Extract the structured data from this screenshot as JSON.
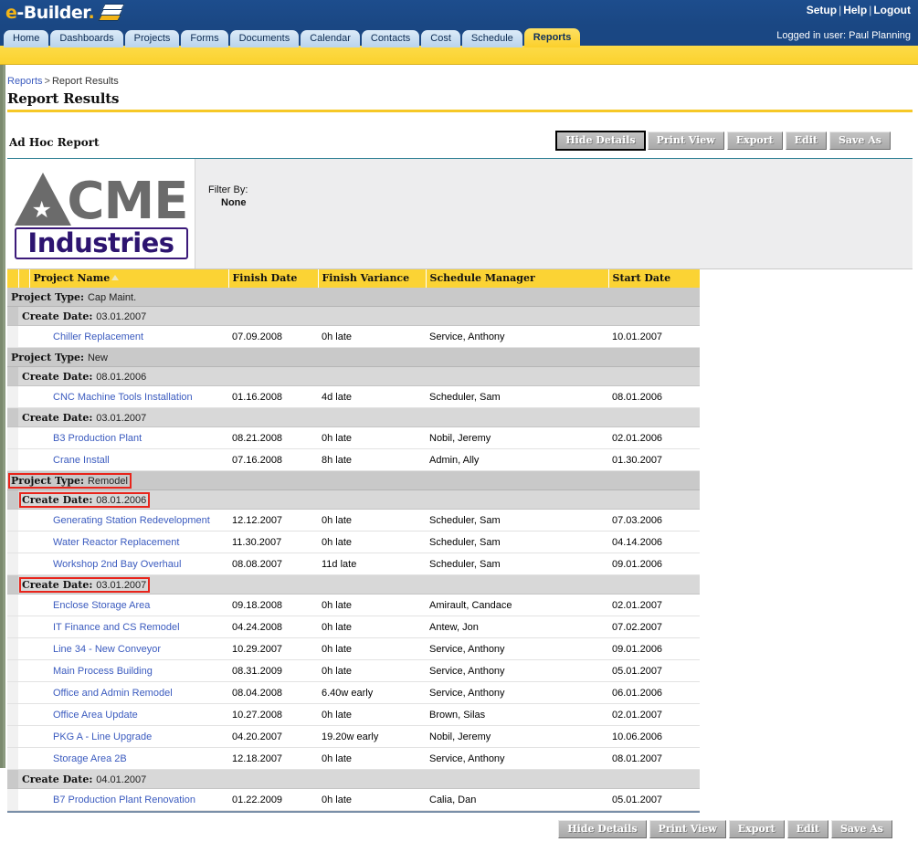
{
  "brand": {
    "name_prefix": "e",
    "name_main": "-Builder",
    "name_dot": "."
  },
  "topnav": {
    "setup": "Setup",
    "help": "Help",
    "logout": "Logout",
    "sep": "|"
  },
  "tabs": [
    {
      "label": "Home",
      "active": false
    },
    {
      "label": "Dashboards",
      "active": false
    },
    {
      "label": "Projects",
      "active": false
    },
    {
      "label": "Forms",
      "active": false
    },
    {
      "label": "Documents",
      "active": false
    },
    {
      "label": "Calendar",
      "active": false
    },
    {
      "label": "Contacts",
      "active": false
    },
    {
      "label": "Cost",
      "active": false
    },
    {
      "label": "Schedule",
      "active": false
    },
    {
      "label": "Reports",
      "active": true
    }
  ],
  "logged_in": "Logged in user: Paul Planning",
  "breadcrumb": {
    "parent": "Reports",
    "sep": ">",
    "current": "Report Results"
  },
  "page_title": "Report Results",
  "report": {
    "title": "Ad Hoc Report",
    "filter_label": "Filter By:",
    "filter_value": "None",
    "logo": {
      "star": "★",
      "word_top": "CME",
      "word_bottom": "Industries"
    }
  },
  "buttons": [
    {
      "label": "Hide Details",
      "focused": true
    },
    {
      "label": "Print View",
      "focused": false
    },
    {
      "label": "Export",
      "focused": false
    },
    {
      "label": "Edit",
      "focused": false
    },
    {
      "label": "Save As",
      "focused": false
    }
  ],
  "buttons_bottom": [
    {
      "label": "Hide Details",
      "focused": false
    },
    {
      "label": "Print View",
      "focused": false
    },
    {
      "label": "Export",
      "focused": false
    },
    {
      "label": "Edit",
      "focused": false
    },
    {
      "label": "Save As",
      "focused": false
    }
  ],
  "table": {
    "columns": [
      "Project Name",
      "Finish Date",
      "Finish Variance",
      "Schedule Manager",
      "Start Date"
    ],
    "sort_column": "Project Name",
    "sort_direction": "ascending",
    "group_label": "Project Type:",
    "subgroup_label": "Create Date:",
    "rows": [
      {
        "kind": "group",
        "value": "Cap Maint.",
        "highlight": false
      },
      {
        "kind": "subgroup",
        "value": "03.01.2007",
        "highlight": false
      },
      {
        "kind": "data",
        "name": "Chiller Replacement",
        "finish": "07.09.2008",
        "variance": "0h late",
        "manager": "Service, Anthony",
        "start": "10.01.2007"
      },
      {
        "kind": "group",
        "value": "New",
        "highlight": false
      },
      {
        "kind": "subgroup",
        "value": "08.01.2006",
        "highlight": false
      },
      {
        "kind": "data",
        "name": "CNC Machine Tools Installation",
        "finish": "01.16.2008",
        "variance": "4d late",
        "manager": "Scheduler, Sam",
        "start": "08.01.2006"
      },
      {
        "kind": "subgroup",
        "value": "03.01.2007",
        "highlight": false
      },
      {
        "kind": "data",
        "name": "B3 Production Plant",
        "finish": "08.21.2008",
        "variance": "0h late",
        "manager": "Nobil, Jeremy",
        "start": "02.01.2006"
      },
      {
        "kind": "data",
        "name": "Crane Install",
        "finish": "07.16.2008",
        "variance": "8h late",
        "manager": "Admin, Ally",
        "start": "01.30.2007"
      },
      {
        "kind": "group",
        "value": "Remodel",
        "highlight": true
      },
      {
        "kind": "subgroup",
        "value": "08.01.2006",
        "highlight": true
      },
      {
        "kind": "data",
        "name": "Generating Station Redevelopment",
        "finish": "12.12.2007",
        "variance": "0h late",
        "manager": "Scheduler, Sam",
        "start": "07.03.2006"
      },
      {
        "kind": "data",
        "name": "Water Reactor Replacement",
        "finish": "11.30.2007",
        "variance": "0h late",
        "manager": "Scheduler, Sam",
        "start": "04.14.2006"
      },
      {
        "kind": "data",
        "name": "Workshop 2nd Bay Overhaul",
        "finish": "08.08.2007",
        "variance": "11d late",
        "manager": "Scheduler, Sam",
        "start": "09.01.2006"
      },
      {
        "kind": "subgroup",
        "value": "03.01.2007",
        "highlight": true
      },
      {
        "kind": "data",
        "name": "Enclose Storage Area",
        "finish": "09.18.2008",
        "variance": "0h late",
        "manager": "Amirault, Candace",
        "start": "02.01.2007"
      },
      {
        "kind": "data",
        "name": "IT Finance and CS Remodel",
        "finish": "04.24.2008",
        "variance": "0h late",
        "manager": "Antew, Jon",
        "start": "07.02.2007"
      },
      {
        "kind": "data",
        "name": "Line 34 - New Conveyor",
        "finish": "10.29.2007",
        "variance": "0h late",
        "manager": "Service, Anthony",
        "start": "09.01.2006"
      },
      {
        "kind": "data",
        "name": "Main Process Building",
        "finish": "08.31.2009",
        "variance": "0h late",
        "manager": "Service, Anthony",
        "start": "05.01.2007"
      },
      {
        "kind": "data",
        "name": "Office and Admin Remodel",
        "finish": "08.04.2008",
        "variance": "6.40w early",
        "manager": "Service, Anthony",
        "start": "06.01.2006"
      },
      {
        "kind": "data",
        "name": "Office Area Update",
        "finish": "10.27.2008",
        "variance": "0h late",
        "manager": "Brown, Silas",
        "start": "02.01.2007"
      },
      {
        "kind": "data",
        "name": "PKG A - Line Upgrade",
        "finish": "04.20.2007",
        "variance": "19.20w early",
        "manager": "Nobil, Jeremy",
        "start": "10.06.2006"
      },
      {
        "kind": "data",
        "name": "Storage Area 2B",
        "finish": "12.18.2007",
        "variance": "0h late",
        "manager": "Service, Anthony",
        "start": "08.01.2007"
      },
      {
        "kind": "subgroup",
        "value": "04.01.2007",
        "highlight": false
      },
      {
        "kind": "data",
        "name": "B7 Production Plant Renovation",
        "finish": "01.22.2009",
        "variance": "0h late",
        "manager": "Calia, Dan",
        "start": "05.01.2007"
      }
    ]
  },
  "colors": {
    "header_blue": "#1a4783",
    "accent_yellow": "#fbd22e",
    "link_blue": "#3b5bbf",
    "highlight_red": "#e8241b",
    "group_gray": "#c9c9c9"
  }
}
